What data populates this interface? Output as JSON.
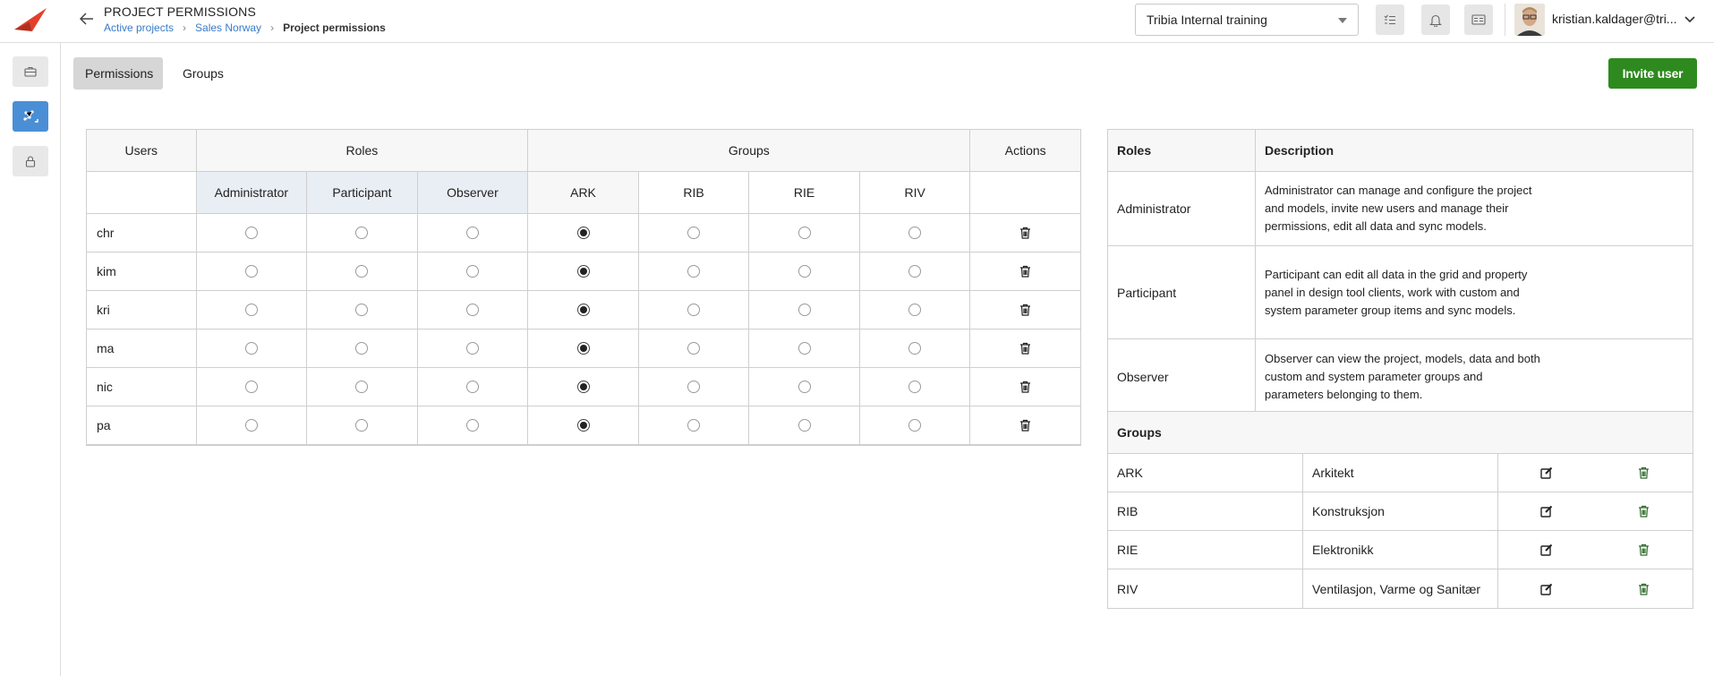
{
  "header": {
    "title": "PROJECT PERMISSIONS",
    "breadcrumb": [
      "Active projects",
      "Sales Norway",
      "Project permissions"
    ],
    "project_select": "Tribia Internal training",
    "user_name": "kristian.kaldager@tri..."
  },
  "tabs": [
    "Permissions",
    "Groups"
  ],
  "invite_label": "Invite user",
  "grid": {
    "users_header": "Users",
    "roles_header": "Roles",
    "groups_header": "Groups",
    "actions_header": "Actions",
    "roles": [
      "Administrator",
      "Participant",
      "Observer"
    ],
    "groups": [
      "ARK",
      "RIB",
      "RIE",
      "RIV"
    ],
    "rows": [
      {
        "user": "chr",
        "role": null,
        "group": "ARK"
      },
      {
        "user": "kim",
        "role": null,
        "group": "ARK"
      },
      {
        "user": "kri",
        "role": null,
        "group": "ARK"
      },
      {
        "user": "ma",
        "role": null,
        "group": "ARK"
      },
      {
        "user": "nic",
        "role": null,
        "group": "ARK"
      },
      {
        "user": "pa",
        "role": null,
        "group": "ARK"
      }
    ]
  },
  "roles_table": {
    "header_role": "Roles",
    "header_desc": "Description",
    "rows": [
      {
        "role": "Administrator",
        "desc": "Administrator can manage and configure the project and models, invite new users and manage their permissions, edit all data and sync models."
      },
      {
        "role": "Participant",
        "desc": "Participant can edit all data in the grid and property panel in design tool clients, work with custom and system parameter group items and sync models."
      },
      {
        "role": "Observer",
        "desc": "Observer can view the project, models, data and both custom and system parameter groups and parameters belonging to them."
      }
    ]
  },
  "groups_table": {
    "header": "Groups",
    "rows": [
      {
        "code": "ARK",
        "name": "Arkitekt"
      },
      {
        "code": "RIB",
        "name": "Konstruksjon"
      },
      {
        "code": "RIE",
        "name": "Elektronikk"
      },
      {
        "code": "RIV",
        "name": "Ventilasjon, Varme og Sanitær"
      }
    ]
  },
  "colors": {
    "accent": "#4a8fd6",
    "invite": "#2e8a1f",
    "link": "#3a7bc8",
    "logo": "#e2402b"
  }
}
